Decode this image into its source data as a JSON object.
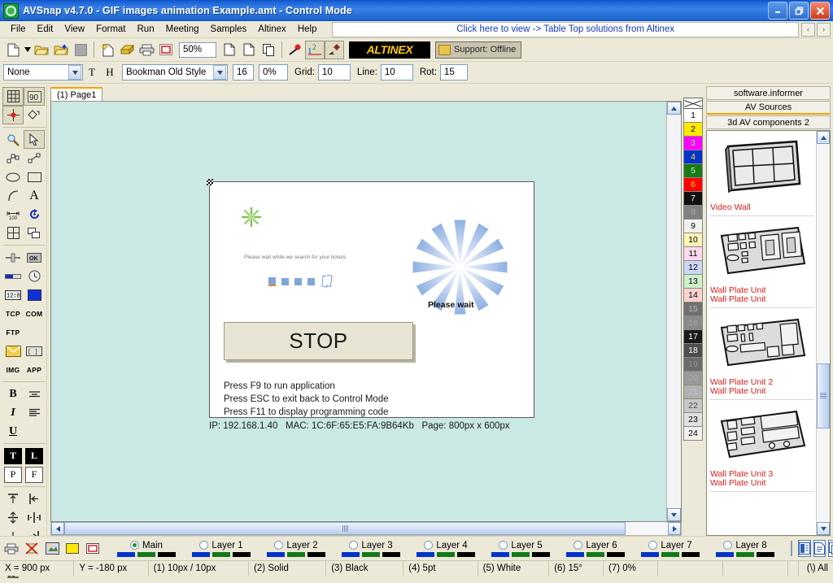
{
  "window": {
    "app_name": "AVSnap v4.7.0",
    "document": "GIF images animation Example.amt",
    "mode": "Control Mode",
    "title_full": "AVSnap v4.7.0  - GIF images animation Example.amt   - Control Mode",
    "minimize": "_",
    "maximize": "❐",
    "close": "✕"
  },
  "menu": {
    "items": [
      "File",
      "Edit",
      "View",
      "Format",
      "Run",
      "Meeting",
      "Samples",
      "Altinex",
      "Help"
    ],
    "promo_text": "Click here to view -> Table Top solutions from Altinex",
    "nav_prev": "‹",
    "nav_next": "›"
  },
  "toolbar1": {
    "zoom_value": "50%",
    "brand_logo": "ALTINEX",
    "support_label": "Support: Offline",
    "icons": [
      "new-document-icon",
      "dropdown-arrow-icon",
      "open-folder-icon",
      "open-folder-add-icon",
      "gray-square-icon",
      "new-page-icon",
      "save-icon",
      "print-icon",
      "print-preview-icon",
      "copy-page-icon",
      "paste-page-icon",
      "duplicate-page-icon",
      "marker-icon",
      "order-numbers-icon",
      "snap-point-icon"
    ]
  },
  "toolbar2": {
    "style_value": "None",
    "text_icon": "T",
    "height_icon": "H",
    "font_value": "Bookman Old Style",
    "font_size": "16",
    "percent": "0%",
    "grid_label": "Grid:",
    "grid_value": "10",
    "line_label": "Line:",
    "line_value": "10",
    "rot_label": "Rot:",
    "rot_value": "15"
  },
  "left_tools": {
    "group1": [
      "grid-icon",
      "rotate-90-icon",
      "snap-center-icon",
      "diamond-shape-icon"
    ],
    "group2": [
      "zoom-magnifier-icon",
      "pointer-arrow-icon",
      "polyline-node-icon",
      "line-node-icon",
      "ellipse-icon",
      "rectangle-icon",
      "arc-icon",
      "text-tool-icon",
      "dimension-icon",
      "rotate-tool-icon",
      "table-icon",
      "duplicate-shape-icon"
    ],
    "group3": [
      "slider-icon",
      "ok-button-icon",
      "progress-bar-icon",
      "clock-icon",
      "digital-display-icon",
      "color-swatch-icon"
    ],
    "labels": [
      "TCP",
      "COM",
      "FTP"
    ],
    "group4": [
      "email-icon",
      "app-window-icon"
    ],
    "labels2": [
      "IMG",
      "APP"
    ],
    "format": [
      "B",
      "I",
      "U",
      "align-strike-icon",
      "align-left-icon"
    ],
    "anchors": [
      "T",
      "L",
      "P",
      "F"
    ],
    "align_icons": [
      "align-top-icon",
      "align-left-edge-icon",
      "align-middle-icon",
      "align-center-v-icon",
      "align-bottom-icon",
      "align-right-edge-icon",
      "distribute-h-icon",
      "distribute-v-icon"
    ]
  },
  "tabs": {
    "page_tab": "(1) Page1"
  },
  "canvas": {
    "object": {
      "gif_caption": "Please wait while we search for your tickets",
      "spinner_label": "Please wait",
      "stop_button": "STOP",
      "notes": [
        "Press F9 to run application",
        "Press ESC to exit back to Control Mode",
        "Press F11 to display programming code"
      ]
    },
    "info": {
      "ip": "IP: 192.168.1.40",
      "mac": "MAC: 1C:6F:65:E5:FA:9B64Kb",
      "page": "Page: 800px x 600px"
    }
  },
  "color_strip": {
    "none_swatch": "none-color-swatch",
    "swatches": [
      {
        "n": "1",
        "bg": "#ffffff",
        "fg": "#000000"
      },
      {
        "n": "2",
        "bg": "#ffe800",
        "fg": "#000000"
      },
      {
        "n": "3",
        "bg": "#ff00ff",
        "fg": "#66ff66"
      },
      {
        "n": "4",
        "bg": "#0033cc",
        "fg": "#ffe800"
      },
      {
        "n": "5",
        "bg": "#1a7a1a",
        "fg": "#aaffaa"
      },
      {
        "n": "6",
        "bg": "#ff0000",
        "fg": "#ffe800"
      },
      {
        "n": "7",
        "bg": "#111111",
        "fg": "#ffffff"
      },
      {
        "n": "8",
        "bg": "#808080",
        "fg": "#a6a6a6"
      },
      {
        "n": "9",
        "bg": "#f2f2f2",
        "fg": "#000000"
      },
      {
        "n": "10",
        "bg": "#fff4b8",
        "fg": "#000000"
      },
      {
        "n": "11",
        "bg": "#ffd9ef",
        "fg": "#000000"
      },
      {
        "n": "12",
        "bg": "#ccd6f5",
        "fg": "#000000"
      },
      {
        "n": "13",
        "bg": "#cdf0cd",
        "fg": "#000000"
      },
      {
        "n": "14",
        "bg": "#ffd2d2",
        "fg": "#000000"
      },
      {
        "n": "15",
        "bg": "#707070",
        "fg": "#b8b8b8"
      },
      {
        "n": "16",
        "bg": "#8a8a8a",
        "fg": "#a8a8a8"
      },
      {
        "n": "17",
        "bg": "#1a1a1a",
        "fg": "#ffffff"
      },
      {
        "n": "18",
        "bg": "#4d4d4d",
        "fg": "#ffffff"
      },
      {
        "n": "19",
        "bg": "#6b6b6b",
        "fg": "#8e8e8e"
      },
      {
        "n": "20",
        "bg": "#999999",
        "fg": "#b3b3b3"
      },
      {
        "n": "21",
        "bg": "#b0b0b0",
        "fg": "#c4c4c4"
      },
      {
        "n": "22",
        "bg": "#c8c8c8",
        "fg": "#4d4d4d"
      },
      {
        "n": "23",
        "bg": "#e0e0e0",
        "fg": "#000000"
      },
      {
        "n": "24",
        "bg": "#f0f0f0",
        "fg": "#000000"
      }
    ]
  },
  "right_panel": {
    "header_informer": "software.informer",
    "header_sources": "AV Sources",
    "header_category": "3d AV components 2",
    "items": [
      {
        "caption1": "Video Wall",
        "caption2": "",
        "icon": "video-wall-thumb"
      },
      {
        "caption1": "Wall Plate Unit",
        "caption2": "Wall Plate Unit",
        "icon": "wall-plate-unit-thumb"
      },
      {
        "caption1": "Wall Plate Unit 2",
        "caption2": "Wall Plate Unit",
        "icon": "wall-plate-unit-2-thumb"
      },
      {
        "caption1": "Wall Plate Unit 3",
        "caption2": "Wall Plate Unit",
        "icon": "wall-plate-unit-3-thumb"
      }
    ],
    "scroll_up": "▲",
    "scroll_down": "▼"
  },
  "layer_bar": {
    "icons": [
      "print-layer-icon",
      "no-export-icon",
      "preview-icon",
      "yellow-fill-icon",
      "red-outline-icon"
    ],
    "layers": [
      {
        "label": "Main",
        "selected": true
      },
      {
        "label": "Layer 1",
        "selected": false
      },
      {
        "label": "Layer 2",
        "selected": false
      },
      {
        "label": "Layer 3",
        "selected": false
      },
      {
        "label": "Layer 4",
        "selected": false
      },
      {
        "label": "Layer 5",
        "selected": false
      },
      {
        "label": "Layer 6",
        "selected": false
      },
      {
        "label": "Layer 7",
        "selected": false
      },
      {
        "label": "Layer 8",
        "selected": false
      }
    ],
    "name_field": "",
    "buttons": [
      "layer-panel-icon",
      "page-properties-icon",
      "copy-pages-icon"
    ]
  },
  "status_bar": {
    "cells": [
      "X = 900 px",
      "Y = -180 px",
      "(1) 10px / 10px",
      "(2) Solid",
      "(3) Black",
      "(4) 5pt",
      "(5) White",
      "(6) 15°",
      "(7) 0%",
      "",
      "",
      ""
    ],
    "right_cell": "(\\) All"
  },
  "colors": {
    "title_blue": "#1a63d6",
    "chrome": "#ece9d8",
    "canvas_bg": "#cae8e4",
    "accent_orange": "#f0a500",
    "link_blue": "#1437c8",
    "caption_red": "#e01b1b"
  }
}
